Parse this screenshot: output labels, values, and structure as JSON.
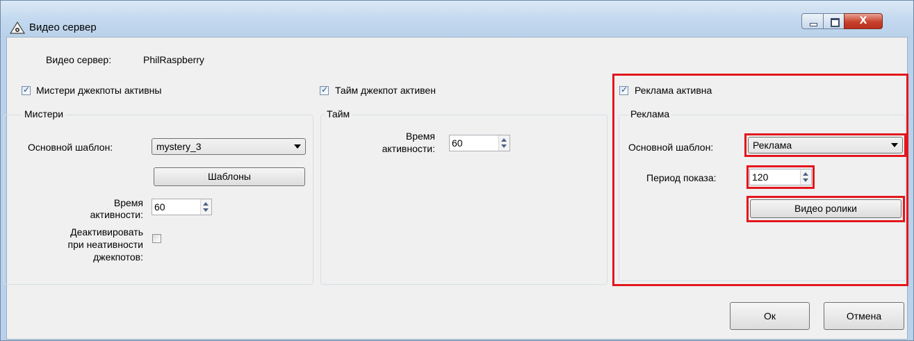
{
  "window": {
    "title": "Видео сервер",
    "close_glyph": "X"
  },
  "server": {
    "label": "Видео сервер:",
    "value": "PhilRaspberry"
  },
  "mystery": {
    "checkbox_label": "Мистери джекпоты активны",
    "checked": true,
    "group_title": "Мистери",
    "template_label": "Основной шаблон:",
    "template_value": "mystery_3",
    "templates_button": "Шаблоны",
    "active_time_label_1": "Время",
    "active_time_label_2": "активности:",
    "active_time_value": "60",
    "deactivate_label_1": "Деактивировать",
    "deactivate_label_2": "при неативности",
    "deactivate_label_3": "джекпотов:",
    "deactivate_checked": false
  },
  "time": {
    "checkbox_label": "Тайм джекпот активен",
    "checked": true,
    "group_title": "Тайм",
    "active_time_label_1": "Время",
    "active_time_label_2": "активности:",
    "active_time_value": "60"
  },
  "ads": {
    "checkbox_label": "Реклама активна",
    "checked": true,
    "group_title": "Реклама",
    "template_label": "Основной шаблон:",
    "template_value": "Реклама",
    "period_label": "Период показа:",
    "period_value": "120",
    "videos_button": "Видео ролики"
  },
  "footer": {
    "ok_label": "Ок",
    "cancel_label": "Отмена"
  },
  "colors": {
    "highlight": "#e3161d",
    "client_bg": "#f0f0f0",
    "frame": "#b9d1ea"
  }
}
